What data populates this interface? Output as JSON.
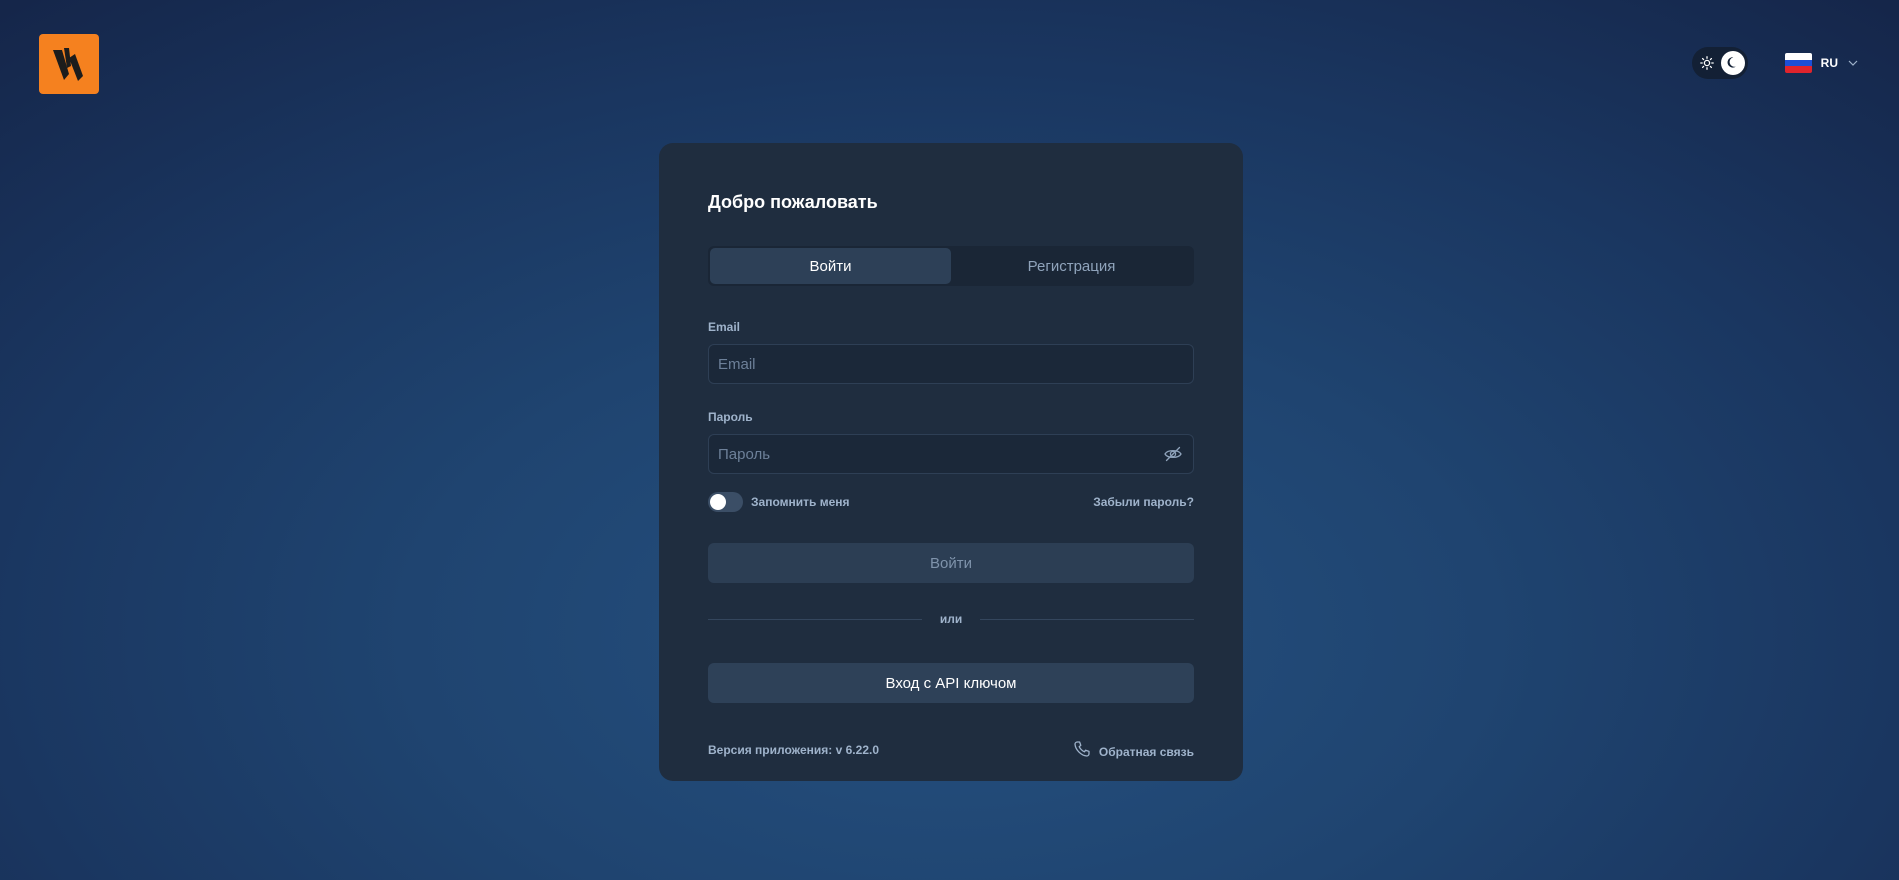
{
  "header": {
    "logo_icon": "brand-w-logo",
    "theme_toggle": {
      "light_icon": "sun-icon",
      "dark_icon": "moon-icon",
      "mode": "dark"
    },
    "language": {
      "code": "RU",
      "flag": "russia-flag"
    }
  },
  "colors": {
    "brand": "#f5811f",
    "card": "#1f2d3f",
    "active_tab": "#2d4057"
  },
  "login": {
    "title": "Добро пожаловать",
    "tabs": [
      {
        "label": "Войти",
        "active": true
      },
      {
        "label": "Регистрация",
        "active": false
      }
    ],
    "email": {
      "label": "Email",
      "placeholder": "Email",
      "value": ""
    },
    "password": {
      "label": "Пароль",
      "placeholder": "Пароль",
      "value": ""
    },
    "remember_me": {
      "label": "Запомнить меня",
      "checked": false
    },
    "forgot_password": "Забыли пароль?",
    "submit_label": "Войти",
    "divider_text": "или",
    "api_key_label": "Вход с API ключом",
    "version_text": "Версия приложения: v 6.22.0",
    "feedback_label": "Обратная связь"
  }
}
